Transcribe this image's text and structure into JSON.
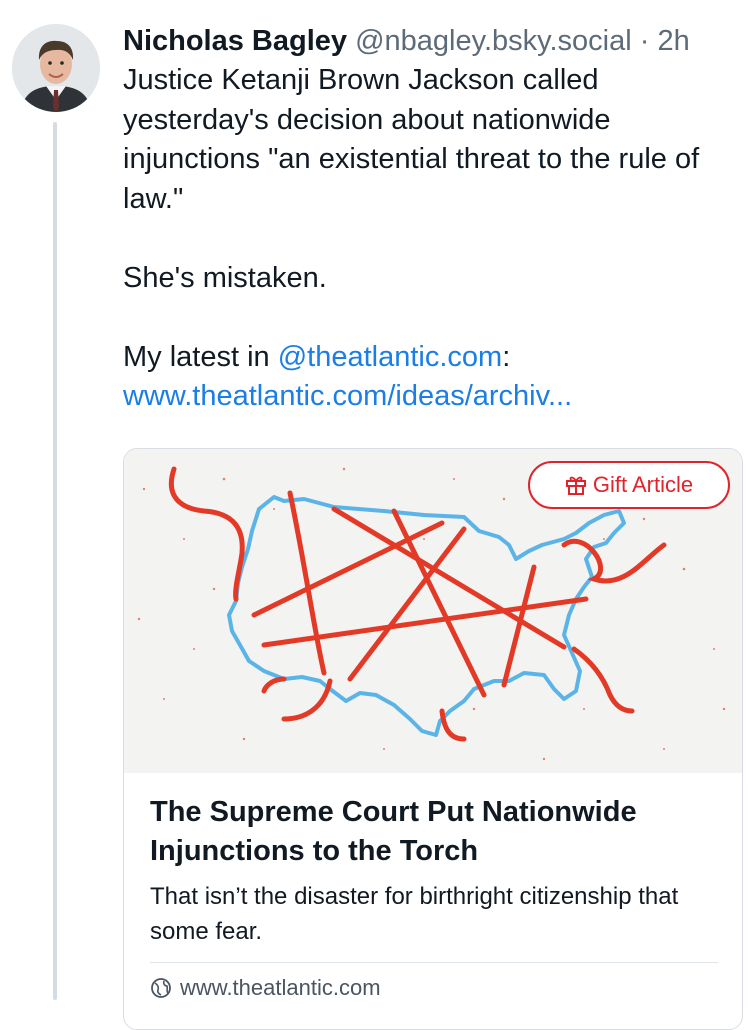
{
  "author": {
    "name": "Nicholas Bagley",
    "handle": "@nbagley.bsky.social",
    "separator": "·",
    "time": "2h"
  },
  "post": {
    "paragraph1": "Justice Ketanji Brown Jackson called yesterday's decision about nationwide injunctions \"an existential threat to the rule of law.\"",
    "paragraph2": "She's mistaken.",
    "paragraph3_prefix": "My latest in ",
    "mention": "@theatlantic.com",
    "paragraph3_suffix": ":",
    "url": "www.theatlantic.com/ideas/archiv..."
  },
  "card": {
    "gift_label": "Gift Article",
    "title": "The Supreme Court Put Nationwide Injunctions to the Torch",
    "description": "That isn’t the disaster for birthright citizenship that some fear.",
    "domain": "www.theatlantic.com"
  },
  "colors": {
    "link": "#1a7ee6",
    "accent_red": "#e0242b",
    "map_blue": "#5ab4e8",
    "thread_line": "#d4dbe2"
  },
  "icons": {
    "gift": "gift-icon",
    "globe": "globe-icon"
  }
}
